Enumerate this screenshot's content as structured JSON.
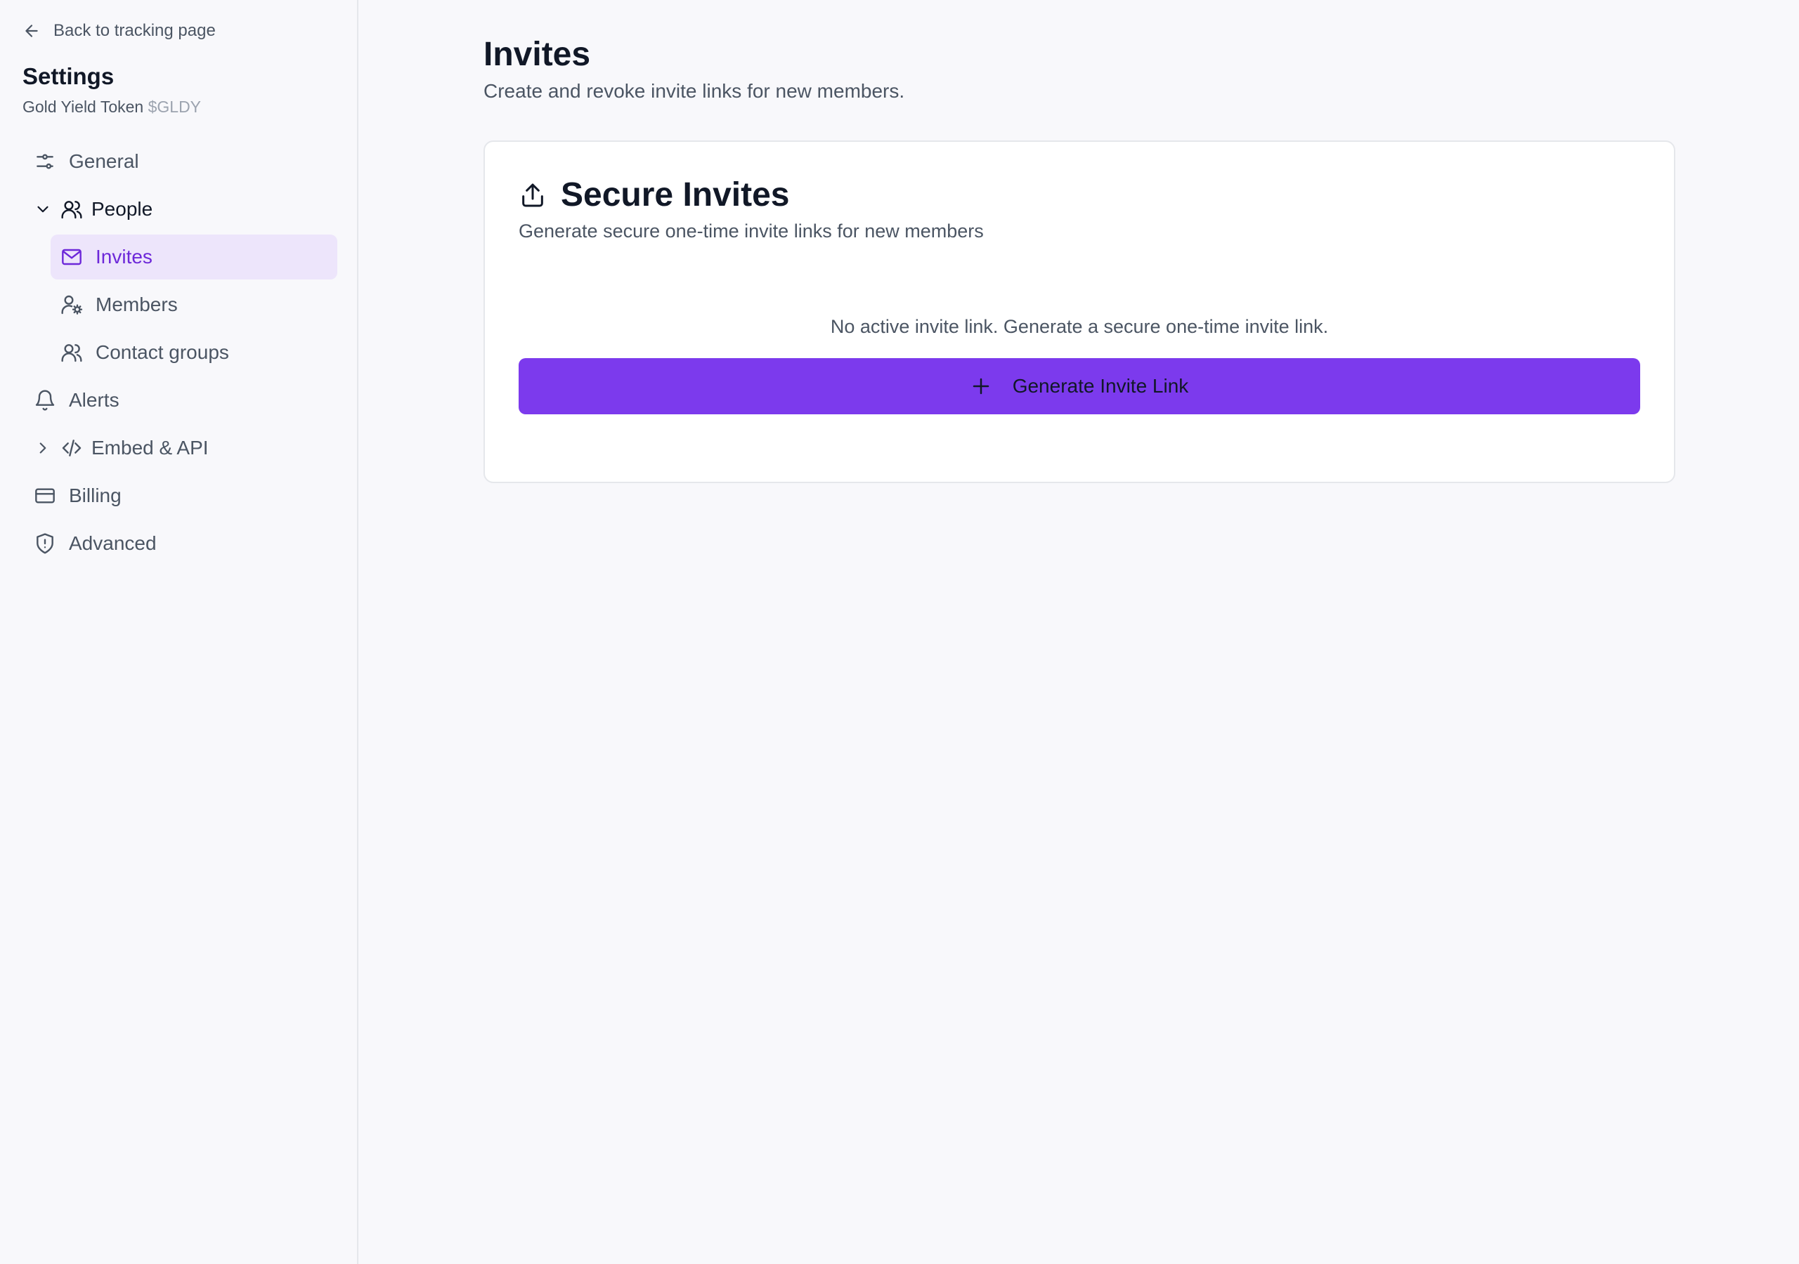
{
  "sidebar": {
    "back_label": "Back to tracking page",
    "title": "Settings",
    "project_name": "Gold Yield Token",
    "project_ticker": "$GLDY",
    "items": [
      {
        "label": "General",
        "icon": "sliders-icon"
      },
      {
        "label": "People",
        "icon": "users-icon",
        "expanded": true,
        "children": [
          {
            "label": "Invites",
            "icon": "mail-icon",
            "active": true
          },
          {
            "label": "Members",
            "icon": "user-cog-icon"
          },
          {
            "label": "Contact groups",
            "icon": "users-icon"
          }
        ]
      },
      {
        "label": "Alerts",
        "icon": "bell-icon"
      },
      {
        "label": "Embed & API",
        "icon": "code-icon",
        "expanded": false
      },
      {
        "label": "Billing",
        "icon": "credit-card-icon"
      },
      {
        "label": "Advanced",
        "icon": "shield-alert-icon"
      }
    ]
  },
  "main": {
    "title": "Invites",
    "subtitle": "Create and revoke invite links for new members.",
    "card": {
      "icon": "share-upload-icon",
      "title": "Secure Invites",
      "description": "Generate secure one-time invite links for new members",
      "empty_message": "No active invite link. Generate a secure one-time invite link.",
      "button_label": "Generate Invite Link",
      "button_icon": "plus-icon"
    }
  },
  "colors": {
    "accent": "#7c3aed",
    "active_bg": "#ede5fb",
    "active_text": "#6d28d9",
    "background": "#f8f8fb"
  }
}
